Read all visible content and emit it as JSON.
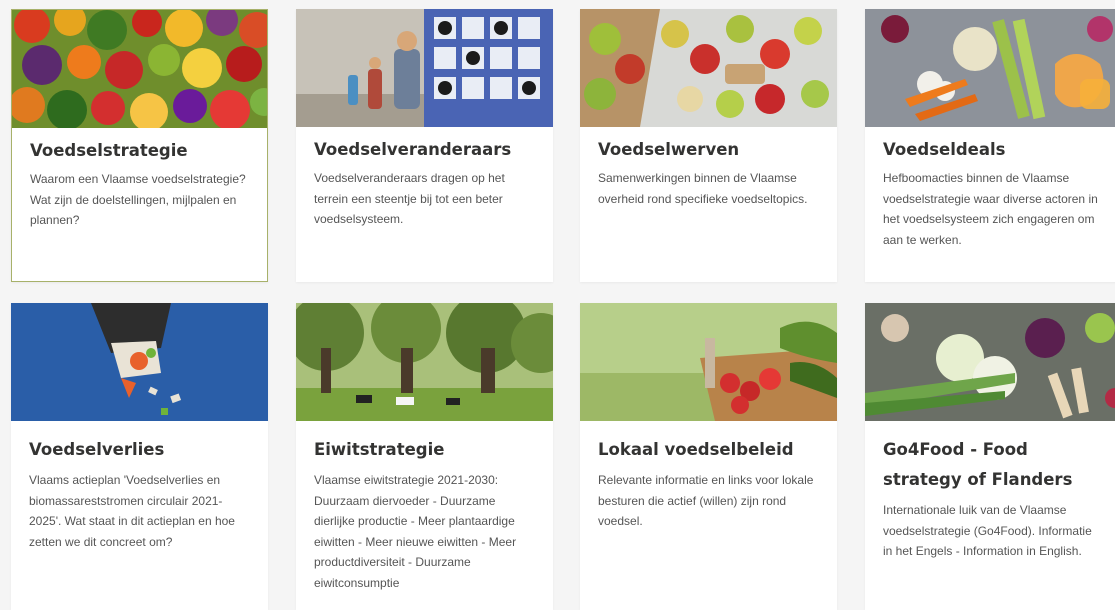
{
  "cards": [
    {
      "title": "Voedselstrategie",
      "desc": "Waarom een Vlaamse voedselstrategie? Wat zijn de doelstellingen, mijlpalen en plannen?",
      "image": "colorful-vegetables-photo"
    },
    {
      "title": "Voedselveranderaars",
      "desc": "Voedselveranderaars dragen op het terrein een steentje bij tot een beter voedselsysteem.",
      "image": "children-at-farm-animal-wall-photo"
    },
    {
      "title": "Voedselwerven",
      "desc": "Samenwerkingen binnen de Vlaamse overheid rond specifieke voedseltopics.",
      "image": "apples-and-pears-on-table-photo"
    },
    {
      "title": "Voedseldeals",
      "desc": "Hefboomacties binnen de Vlaamse voedselstrategie waar diverse actoren in het voedselsysteem zich engageren om aan te werken.",
      "image": "vegetables-on-grey-table-photo"
    },
    {
      "title": "Voedselverlies",
      "desc": "Vlaams actieplan 'Voedselverlies en biomassareststromen circulair 2021-2025'. Wat staat in dit actieplan en hoe zetten we dit concreet om?",
      "image": "food-waste-paper-art-photo"
    },
    {
      "title": "Eiwitstrategie",
      "desc": "Vlaamse eiwitstrategie 2021-2030: Duurzaam diervoeder - Duurzame dierlijke productie - Meer plantaardige eiwitten - Meer nieuwe eiwitten - Meer productdiversiteit - Duurzame eiwitconsumptie",
      "image": "cows-in-meadow-willows-photo"
    },
    {
      "title": "Lokaal voedselbeleid",
      "desc": "Relevante informatie en links voor lokale besturen die actief (willen) zijn rond voedsel.",
      "image": "basket-of-vegetables-photo"
    },
    {
      "title": "Go4Food - Food strategy of Flanders",
      "desc": "Internationale luik van de Vlaamse voedselstrategie (Go4Food). Informatie in het Engels - Information in English.",
      "image": "vegetables-flatlay-photo"
    }
  ]
}
